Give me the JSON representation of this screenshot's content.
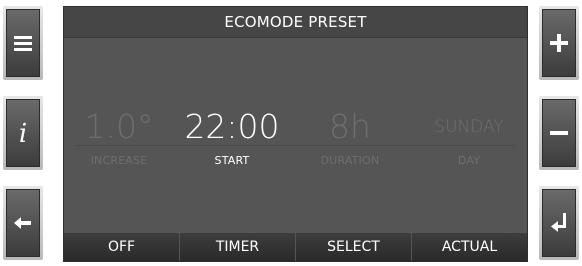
{
  "title": "ECOMODE PRESET",
  "columns": [
    {
      "value": "1.0°",
      "label": "INCREASE",
      "active": false
    },
    {
      "value": "22:00",
      "label": "START",
      "active": true
    },
    {
      "value": "8h",
      "label": "DURATION",
      "active": false
    },
    {
      "value": "SUNDAY",
      "label": "DAY",
      "active": false
    }
  ],
  "bottom_buttons": [
    {
      "label": "OFF"
    },
    {
      "label": "TIMER"
    },
    {
      "label": "SELECT"
    },
    {
      "label": "ACTUAL"
    }
  ],
  "side_buttons": {
    "left": [
      "menu-icon",
      "info-icon",
      "back-arrow-icon"
    ],
    "right": [
      "plus-icon",
      "minus-icon",
      "enter-icon"
    ]
  },
  "colors": {
    "screen_bg": "#555555",
    "active_text": "#ffffff",
    "inactive_text": "#6e6e6e"
  }
}
